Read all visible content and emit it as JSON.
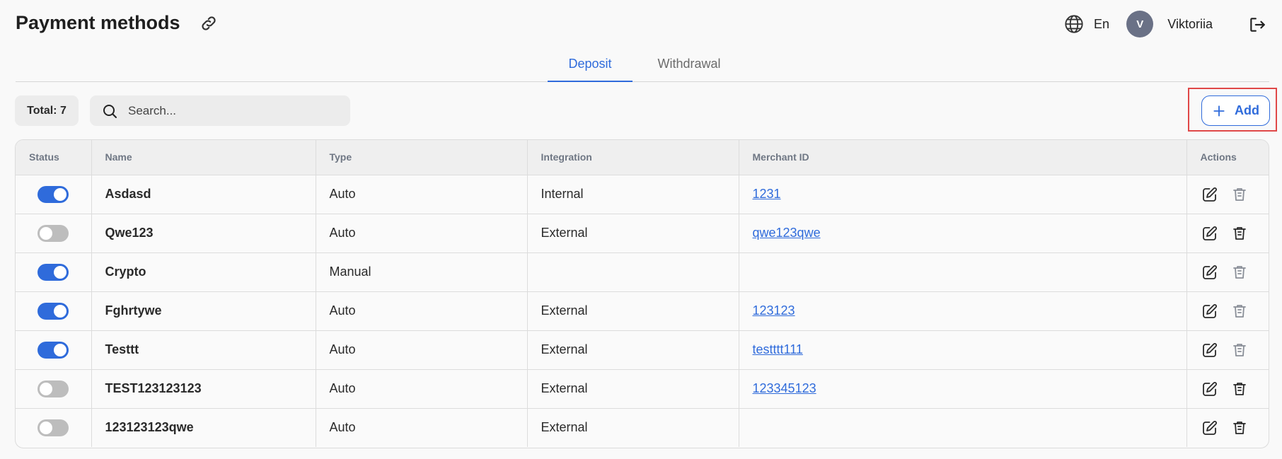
{
  "header": {
    "title": "Payment methods",
    "language": "En",
    "user": {
      "initial": "V",
      "name": "Viktoriia"
    }
  },
  "tabs": [
    {
      "label": "Deposit",
      "active": true
    },
    {
      "label": "Withdrawal",
      "active": false
    }
  ],
  "toolbar": {
    "total_label": "Total: 7",
    "search_placeholder": "Search...",
    "add_label": "Add"
  },
  "table": {
    "columns": [
      "Status",
      "Name",
      "Type",
      "Integration",
      "Merchant ID",
      "Actions"
    ],
    "rows": [
      {
        "enabled": true,
        "name": "Asdasd",
        "type": "Auto",
        "integration": "Internal",
        "merchant_id": "1231",
        "delete_enabled": false
      },
      {
        "enabled": false,
        "name": "Qwe123",
        "type": "Auto",
        "integration": "External",
        "merchant_id": "qwe123qwe",
        "delete_enabled": true
      },
      {
        "enabled": true,
        "name": "Crypto",
        "type": "Manual",
        "integration": "",
        "merchant_id": "",
        "delete_enabled": false
      },
      {
        "enabled": true,
        "name": "Fghrtywe",
        "type": "Auto",
        "integration": "External",
        "merchant_id": "123123",
        "delete_enabled": false
      },
      {
        "enabled": true,
        "name": "Testtt",
        "type": "Auto",
        "integration": "External",
        "merchant_id": "testttt111",
        "delete_enabled": false
      },
      {
        "enabled": false,
        "name": "TEST123123123",
        "type": "Auto",
        "integration": "External",
        "merchant_id": "123345123",
        "delete_enabled": true
      },
      {
        "enabled": false,
        "name": "123123123qwe",
        "type": "Auto",
        "integration": "External",
        "merchant_id": "",
        "delete_enabled": true
      }
    ]
  },
  "colors": {
    "accent": "#2f6bdb",
    "toggle_off": "#bdbdbd",
    "highlight": "#e04848"
  },
  "icons": {
    "title_link": "link-icon",
    "language": "globe-icon",
    "logout": "logout-icon",
    "search": "search-icon",
    "add": "plus-icon",
    "edit": "edit-icon",
    "delete": "trash-icon"
  }
}
